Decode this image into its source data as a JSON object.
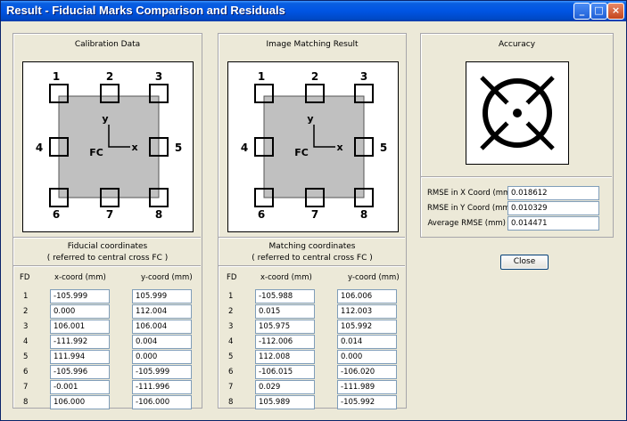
{
  "window": {
    "title": "Result - Fiducial Marks Comparison and Residuals"
  },
  "title_buttons": {
    "minimize": "_",
    "maximize": "□",
    "close": "×"
  },
  "panels": {
    "calibration": {
      "title": "Calibration Data"
    },
    "matching": {
      "title": "Image Matching Result"
    },
    "accuracy": {
      "title": "Accuracy"
    }
  },
  "diagram": {
    "fc_label": "FC",
    "x_label": "x",
    "y_label": "y",
    "marks": [
      "1",
      "2",
      "3",
      "4",
      "5",
      "6",
      "7",
      "8"
    ]
  },
  "fiducial": {
    "title": "Fiducial coordinates",
    "subtitle": "( referred to central cross FC )",
    "fd_header": "FD",
    "x_header": "x-coord (mm)",
    "y_header": "y-coord (mm)",
    "rows": [
      {
        "fd": "1",
        "x": "-105.999",
        "y": "105.999"
      },
      {
        "fd": "2",
        "x": "0.000",
        "y": "112.004"
      },
      {
        "fd": "3",
        "x": "106.001",
        "y": "106.004"
      },
      {
        "fd": "4",
        "x": "-111.992",
        "y": "0.004"
      },
      {
        "fd": "5",
        "x": "111.994",
        "y": "0.000"
      },
      {
        "fd": "6",
        "x": "-105.996",
        "y": "-105.999"
      },
      {
        "fd": "7",
        "x": "-0.001",
        "y": "-111.996"
      },
      {
        "fd": "8",
        "x": "106.000",
        "y": "-106.000"
      }
    ]
  },
  "matching_coords": {
    "title": "Matching coordinates",
    "subtitle": "( referred to central cross FC )",
    "fd_header": "FD",
    "x_header": "x-coord (mm)",
    "y_header": "y-coord (mm)",
    "rows": [
      {
        "fd": "1",
        "x": "-105.988",
        "y": "106.006"
      },
      {
        "fd": "2",
        "x": "0.015",
        "y": "112.003"
      },
      {
        "fd": "3",
        "x": "105.975",
        "y": "105.992"
      },
      {
        "fd": "4",
        "x": "-112.006",
        "y": "0.014"
      },
      {
        "fd": "5",
        "x": "112.008",
        "y": "0.000"
      },
      {
        "fd": "6",
        "x": "-106.015",
        "y": "-106.020"
      },
      {
        "fd": "7",
        "x": "0.029",
        "y": "-111.989"
      },
      {
        "fd": "8",
        "x": "105.989",
        "y": "-105.992"
      }
    ]
  },
  "accuracy": {
    "rmse_x_label": "RMSE in X Coord (mm)",
    "rmse_x": "0.018612",
    "rmse_y_label": "RMSE in Y Coord (mm)",
    "rmse_y": "0.010329",
    "avg_label": "Average RMSE (mm)",
    "avg": "0.014471"
  },
  "close_button": {
    "label": "Close"
  }
}
